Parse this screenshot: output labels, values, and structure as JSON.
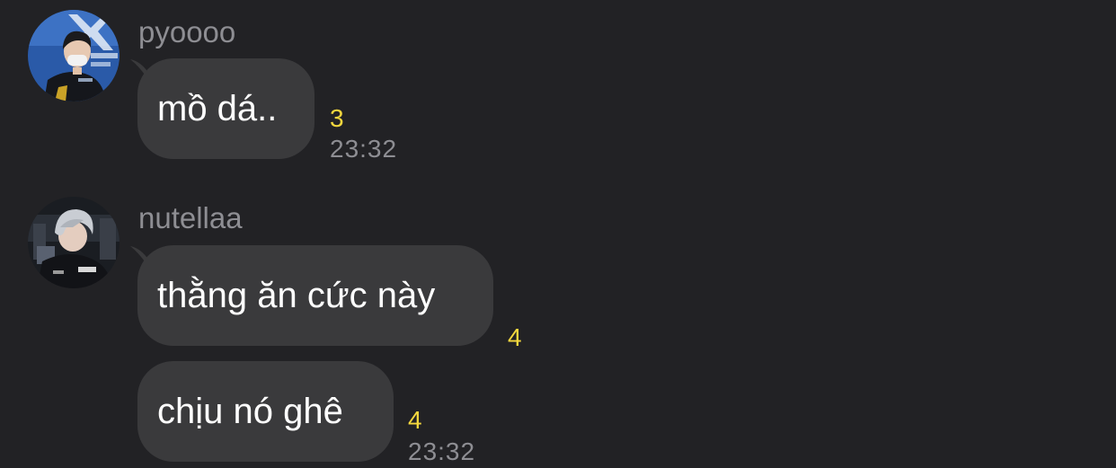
{
  "messages": [
    {
      "sender": "pyoooo",
      "avatar_icon": "avatar-pyoooo-icon",
      "bubbles": [
        {
          "text": "mồ dá..",
          "unread_count": "3",
          "time": "23:32"
        }
      ]
    },
    {
      "sender": "nutellaa",
      "avatar_icon": "avatar-nutellaa-icon",
      "bubbles": [
        {
          "text": "thằng ăn cức này",
          "unread_count": "4"
        },
        {
          "text": "chịu nó ghê",
          "unread_count": "4",
          "time": "23:32"
        }
      ]
    }
  ],
  "colors": {
    "background": "#222225",
    "bubble": "#3a3a3c",
    "bubble_text": "#ffffff",
    "meta_text": "#8e8e93",
    "unread_count": "#f4d73e"
  }
}
